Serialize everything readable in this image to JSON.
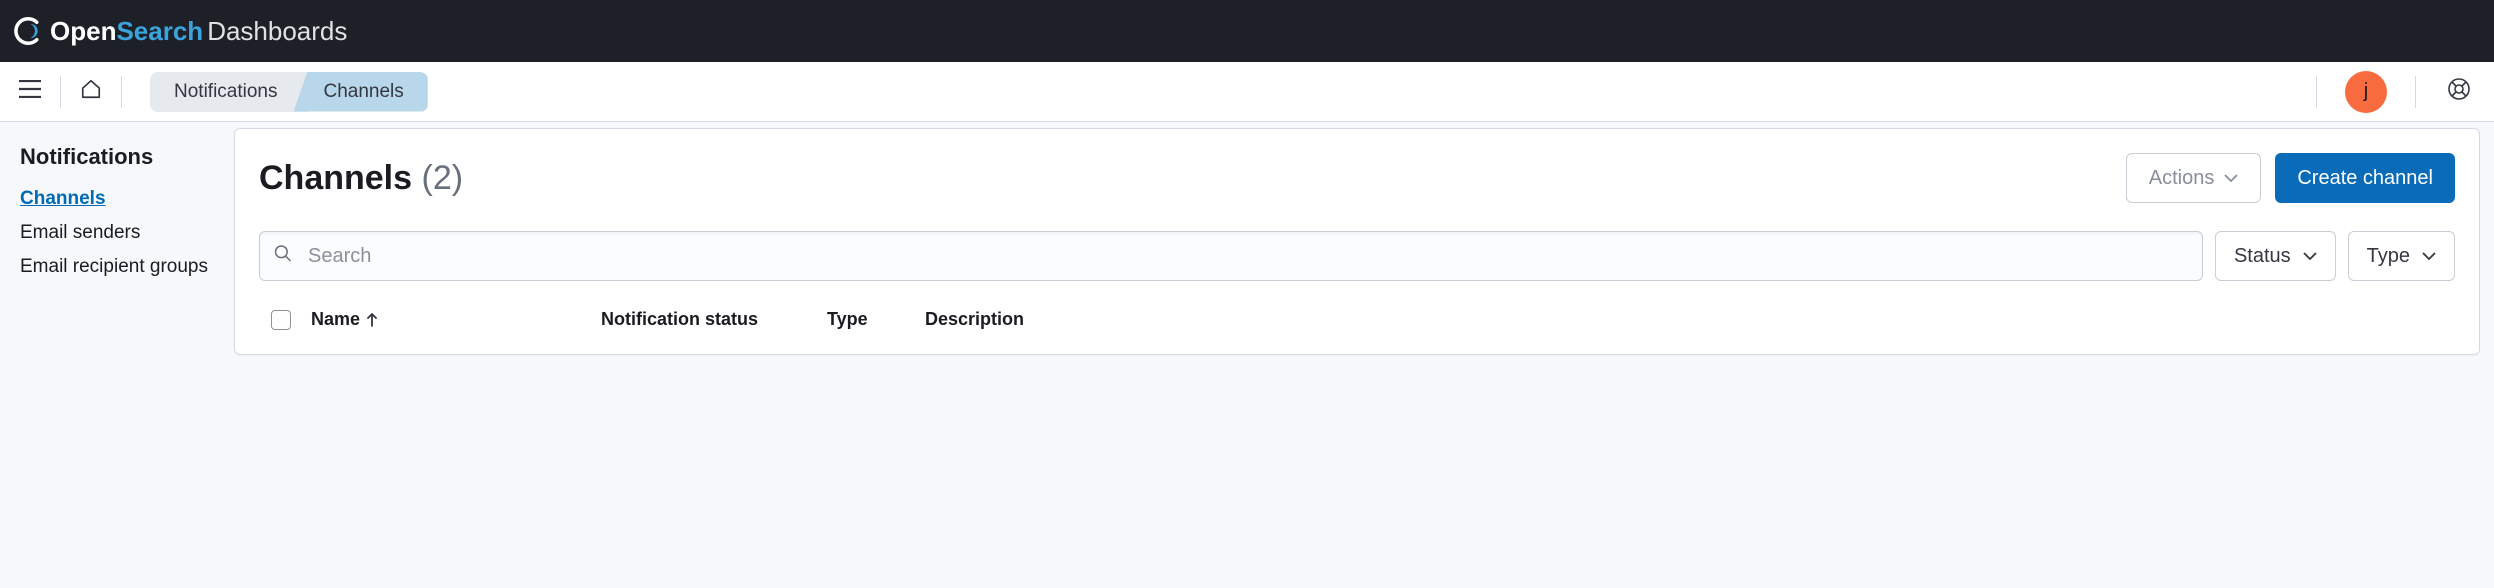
{
  "brand": {
    "open": "Open",
    "search": "Search",
    "dash": "Dashboards"
  },
  "breadcrumbs": {
    "notifications": "Notifications",
    "channels": "Channels"
  },
  "user": {
    "initial": "j"
  },
  "sidebar": {
    "title": "Notifications",
    "items": [
      {
        "label": "Channels",
        "active": true
      },
      {
        "label": "Email senders",
        "active": false
      },
      {
        "label": "Email recipient groups",
        "active": false
      }
    ]
  },
  "panel": {
    "title": "Channels",
    "count": "(2)",
    "actions_label": "Actions",
    "create_label": "Create channel"
  },
  "search": {
    "placeholder": "Search"
  },
  "filters": {
    "status": "Status",
    "type": "Type"
  },
  "table": {
    "columns": {
      "name": "Name",
      "status": "Notification status",
      "type": "Type",
      "desc": "Description"
    }
  }
}
